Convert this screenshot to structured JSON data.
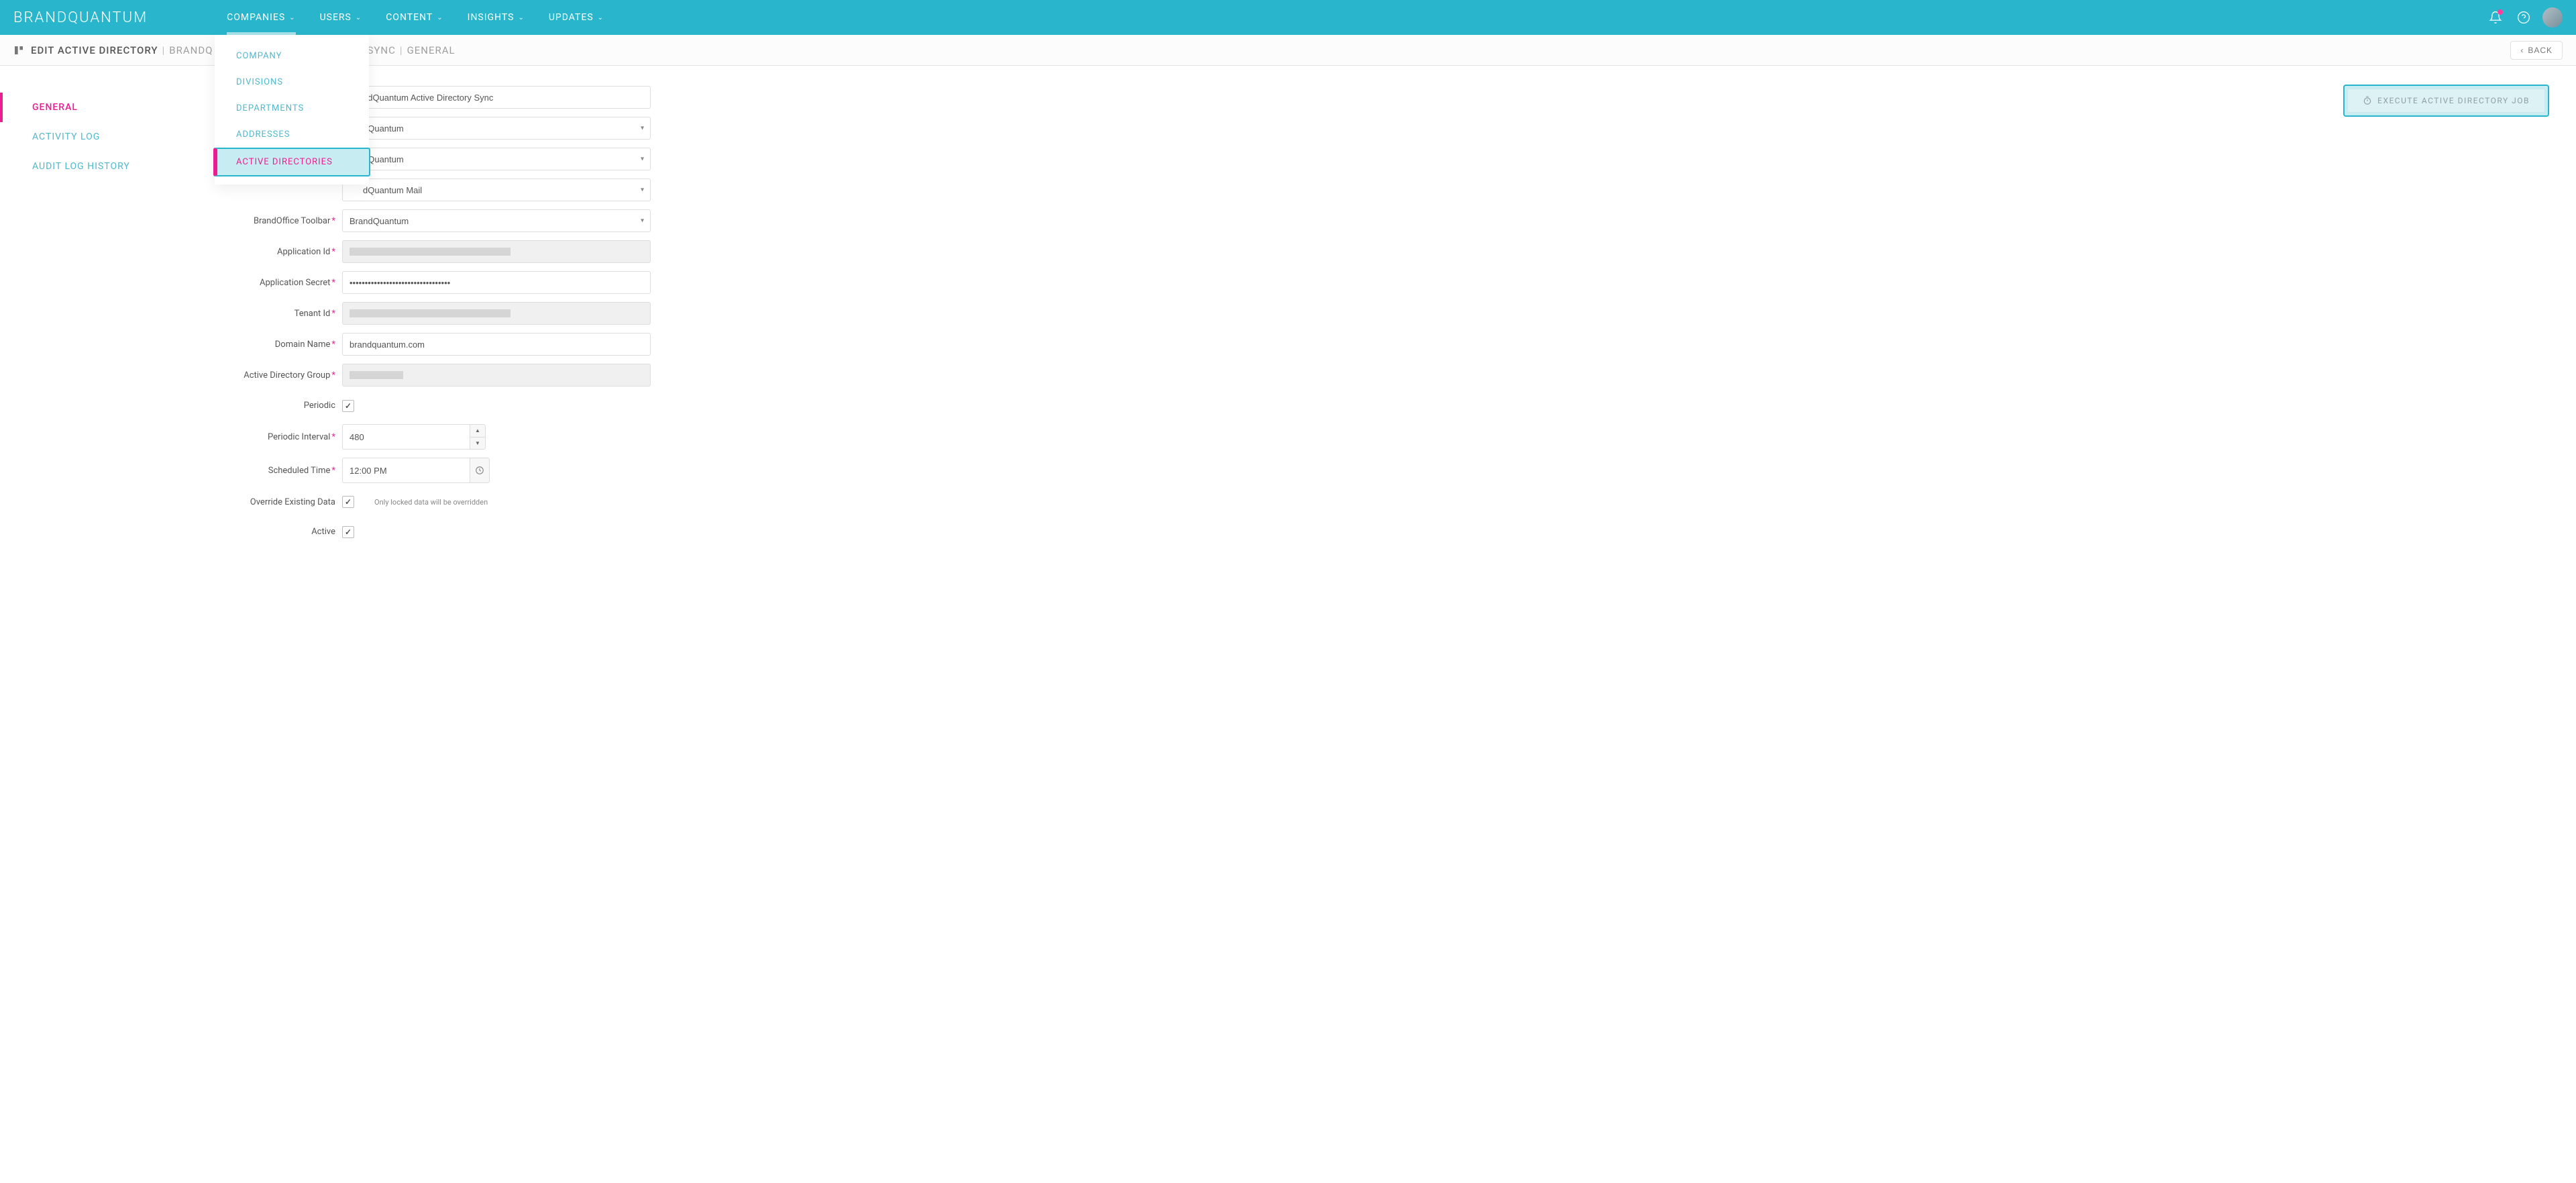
{
  "brand": "BRANDQUANTUM",
  "nav": [
    {
      "label": "COMPANIES",
      "active": true
    },
    {
      "label": "USERS"
    },
    {
      "label": "CONTENT"
    },
    {
      "label": "INSIGHTS"
    },
    {
      "label": "UPDATES"
    }
  ],
  "dropdown": [
    {
      "label": "COMPANY"
    },
    {
      "label": "DIVISIONS"
    },
    {
      "label": "DEPARTMENTS"
    },
    {
      "label": "ADDRESSES"
    },
    {
      "label": "ACTIVE DIRECTORIES",
      "highlight": true
    }
  ],
  "breadcrumb": {
    "part1": "EDIT ACTIVE DIRECTORY",
    "part2_visible": "BRANDQ",
    "part3_visible": "SYNC",
    "part4": "GENERAL"
  },
  "back_label": "BACK",
  "left_tabs": [
    {
      "label": "GENERAL",
      "active": true
    },
    {
      "label": "ACTIVITY LOG"
    },
    {
      "label": "AUDIT LOG HISTORY"
    }
  ],
  "form": {
    "name_visible_part": "ndQuantum Active Directory Sync",
    "company_visible_part": "dQuantum",
    "division_visible_part": "dQuantum",
    "signature_visible_part": "dQuantum Mail",
    "brandoffice_label": "BrandOffice Toolbar",
    "brandoffice_value": "BrandQuantum",
    "appid_label": "Application Id",
    "appsecret_label": "Application Secret",
    "appsecret_dots": "•••••••••••••••••••••••••••••••••",
    "tenantid_label": "Tenant Id",
    "domain_label": "Domain Name",
    "domain_value": "brandquantum.com",
    "adgroup_label": "Active Directory Group",
    "periodic_label": "Periodic",
    "periodic_checked": true,
    "interval_label": "Periodic Interval",
    "interval_value": "480",
    "schedtime_label": "Scheduled Time",
    "schedtime_value": "12:00 PM",
    "override_label": "Override Existing Data",
    "override_checked": true,
    "override_hint": "Only locked data will be overridden",
    "active_label": "Active",
    "active_checked": true
  },
  "exec_button": "EXECUTE ACTIVE DIRECTORY JOB"
}
